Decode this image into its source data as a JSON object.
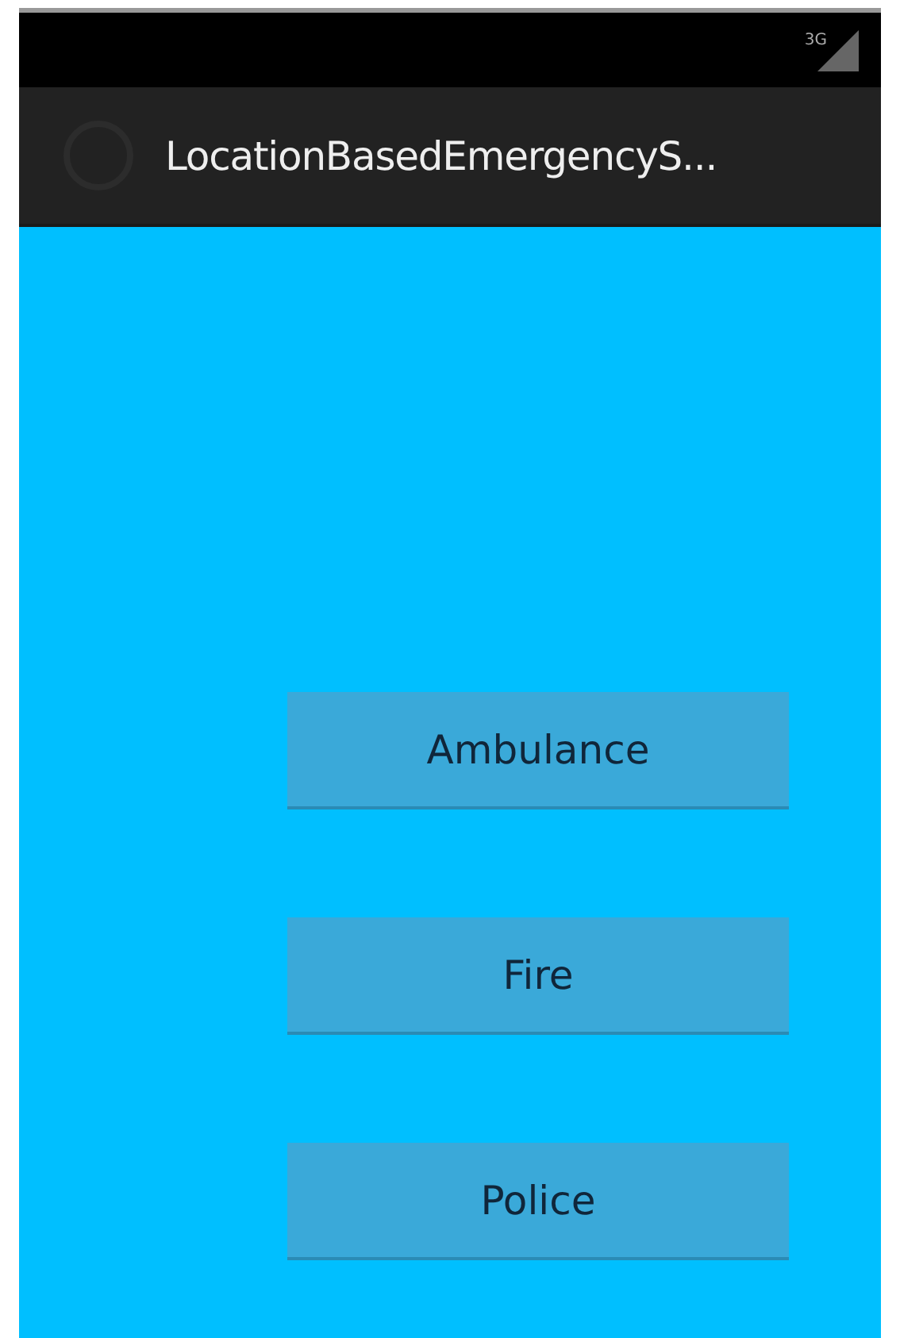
{
  "status_bar": {
    "network": "3G"
  },
  "action_bar": {
    "title": "LocationBasedEmergencyS..."
  },
  "buttons": [
    {
      "label": "Ambulance"
    },
    {
      "label": "Fire"
    },
    {
      "label": "Police"
    }
  ]
}
